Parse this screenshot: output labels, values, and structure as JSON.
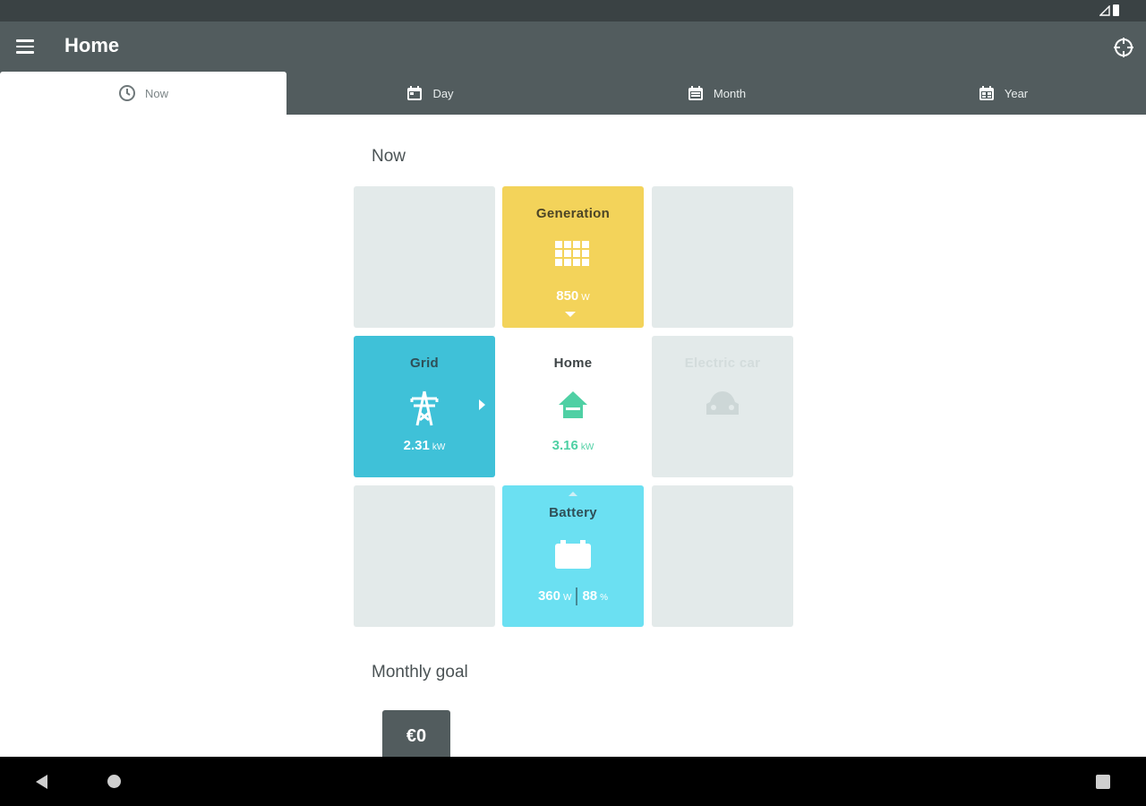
{
  "app": {
    "title": "Home"
  },
  "icons": {
    "menu": "hamburger-menu-icon",
    "target": "crosshair-icon"
  },
  "tabs": [
    {
      "label": "Now",
      "icon": "clock-icon"
    },
    {
      "label": "Day",
      "icon": "calendar-day-icon"
    },
    {
      "label": "Month",
      "icon": "calendar-month-icon"
    },
    {
      "label": "Year",
      "icon": "calendar-year-icon"
    }
  ],
  "now": {
    "title": "Now",
    "generation": {
      "label": "Generation",
      "value": "850",
      "unit": "W",
      "color": "#f3d35a"
    },
    "grid": {
      "label": "Grid",
      "value": "2.31",
      "unit": "kW",
      "color": "#3fc1d8"
    },
    "home": {
      "label": "Home",
      "value": "3.16",
      "unit": "kW",
      "color": "#4fd0a4"
    },
    "electric_car": {
      "label": "Electric car"
    },
    "battery": {
      "label": "Battery",
      "power_value": "360",
      "power_unit": "W",
      "charge_value": "88",
      "charge_unit": "%",
      "color": "#6be0f2"
    }
  },
  "monthly_goal": {
    "title": "Monthly goal",
    "value": "€0"
  }
}
